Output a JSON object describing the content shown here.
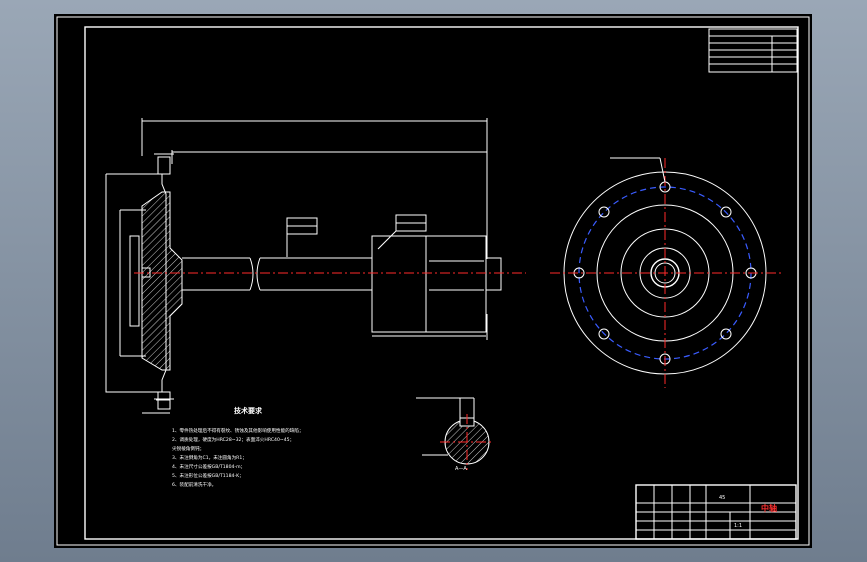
{
  "tech_requirements": {
    "title": "技术要求",
    "items": [
      "1、零件热处理后不得有裂纹、锈蚀及其他影响使用性能的缺陷；",
      "2、调质处理，硬度为HRC28~32；表面淬火HRC40~45；",
      "   尖锐棱角倒钝；",
      "3、未注倒角为C1，未注圆角为R1；",
      "4、未注尺寸公差按GB/T1804-m；",
      "5、未注形位公差按GB/T1184-K；",
      "6、装配前清洗干净。"
    ]
  },
  "title_block": {
    "part_name": "中轴",
    "scale": "1:1",
    "material": "45"
  },
  "section": {
    "label": "A—A"
  },
  "colors": {
    "center_line": "#ff2a2a",
    "bolt_circle": "#3a5cff",
    "linework": "#ffffff",
    "title_accent": "#ff3030"
  }
}
